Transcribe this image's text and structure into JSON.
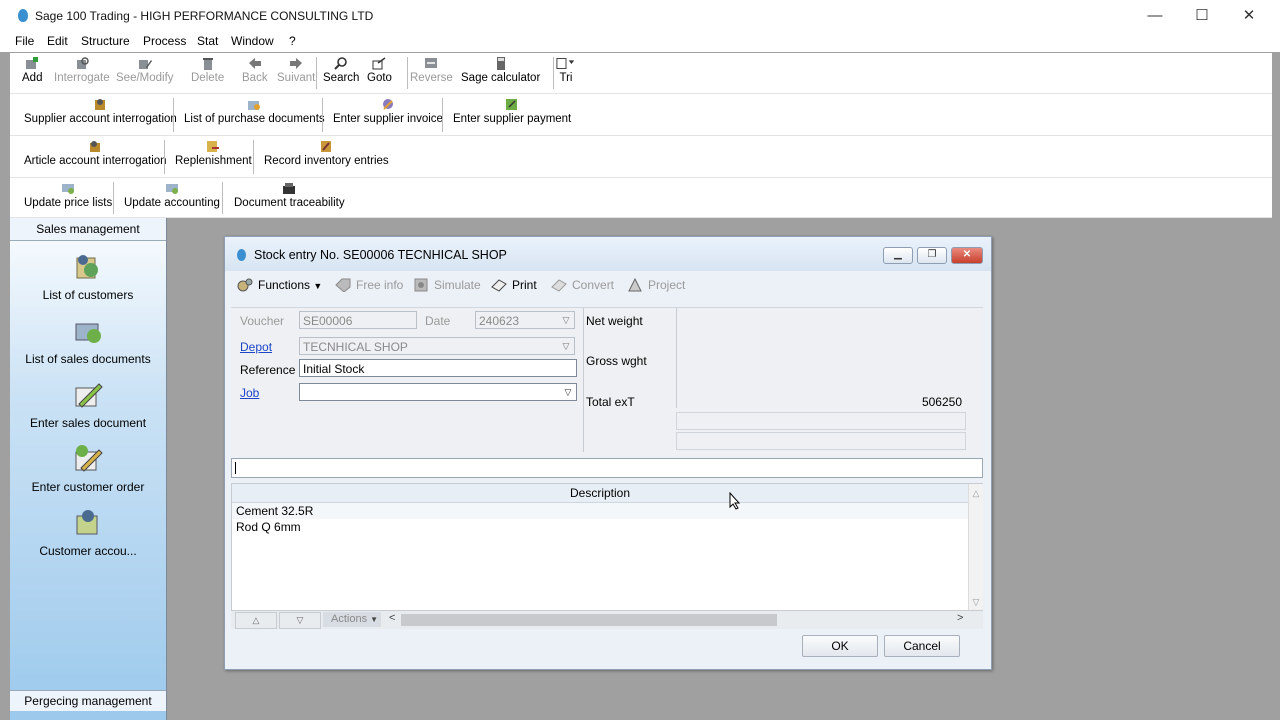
{
  "app": {
    "title": "Sage 100 Trading - HIGH PERFORMANCE CONSULTING LTD",
    "minimize": "—",
    "maximize": "☐",
    "close": "✕"
  },
  "menu": [
    "File",
    "Edit",
    "Structure",
    "Process",
    "Stat",
    "Window",
    "?"
  ],
  "toolbar_main": {
    "add": "Add",
    "interrogate": "Interrogate",
    "see_modify": "See/Modify",
    "delete": "Delete",
    "back": "Back",
    "suivant": "Suivant",
    "search": "Search",
    "goto": "Goto",
    "reverse": "Reverse",
    "sage_calculator": "Sage calculator",
    "tri": "Tri"
  },
  "toolbar_purchase": {
    "supplier_account": "Supplier account interrogation",
    "purchase_docs": "List of purchase documents",
    "supplier_invoice": "Enter supplier invoice",
    "supplier_payment": "Enter supplier payment"
  },
  "toolbar_stock": {
    "article_account": "Article account interrogation",
    "replenishment": "Replenishment",
    "inventory_entries": "Record inventory entries"
  },
  "toolbar_update": {
    "price_lists": "Update price lists",
    "accounting": "Update accounting",
    "traceability": "Document traceability"
  },
  "sidebar": {
    "header": "Sales management",
    "items": [
      "List of customers",
      "List of sales documents",
      "Enter sales document",
      "Enter customer order",
      "Customer accou..."
    ],
    "footer": "Pergecing management"
  },
  "dialog": {
    "title": "Stock entry No. SE00006 TECNHICAL SHOP",
    "tools": {
      "functions": "Functions",
      "free_info": "Free info",
      "simulate": "Simulate",
      "print": "Print",
      "convert": "Convert",
      "project": "Project"
    },
    "form": {
      "voucher_label": "Voucher",
      "voucher_value": "SE00006",
      "date_label": "Date",
      "date_value": "240623",
      "depot_label": "Depot",
      "depot_value": "TECNHICAL SHOP",
      "reference_label": "Reference",
      "reference_value": "Initial Stock",
      "job_label": "Job",
      "job_value": ""
    },
    "totals": {
      "net_weight_label": "Net weight",
      "gross_weight_label": "Gross wght",
      "total_ext_label": "Total exT",
      "total_ext_value": "506250"
    },
    "grid": {
      "header": "Description",
      "rows": [
        "Cement 32.5R",
        "Rod  Q   6mm"
      ]
    },
    "actions_label": "Actions",
    "ok": "OK",
    "cancel": "Cancel"
  }
}
